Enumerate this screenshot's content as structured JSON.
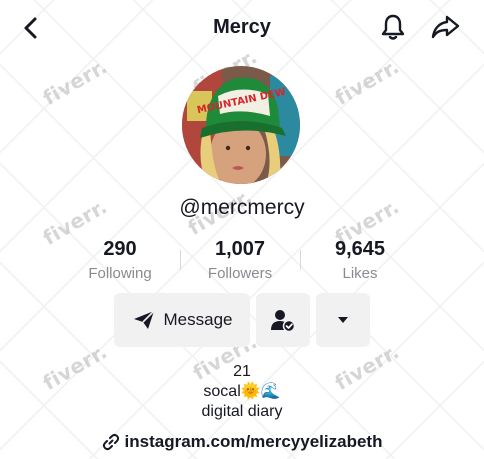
{
  "header": {
    "title": "Mercy",
    "icons": {
      "back": "chevron-left-icon",
      "bell": "bell-icon",
      "share": "share-arrow-icon"
    }
  },
  "profile": {
    "username": "@mercmercy",
    "avatar_cap_text": "MOUNTAIN DEW"
  },
  "stats": [
    {
      "value": "290",
      "label": "Following"
    },
    {
      "value": "1,007",
      "label": "Followers"
    },
    {
      "value": "9,645",
      "label": "Likes"
    }
  ],
  "actions": {
    "message_label": "Message",
    "icons": {
      "message": "paper-plane-icon",
      "friend": "person-check-icon",
      "more": "caret-down-icon"
    }
  },
  "bio": {
    "line1": "21",
    "line2_text": "socal",
    "line2_emojis": "🌞🌊",
    "line3": "digital diary"
  },
  "link": {
    "text": "instagram.com/mercyyelizabeth",
    "icon": "link-icon"
  },
  "watermark": {
    "text": "fiverr."
  },
  "colors": {
    "text": "#161823",
    "muted": "#8a8b91",
    "button_bg": "#f1f1f2"
  }
}
